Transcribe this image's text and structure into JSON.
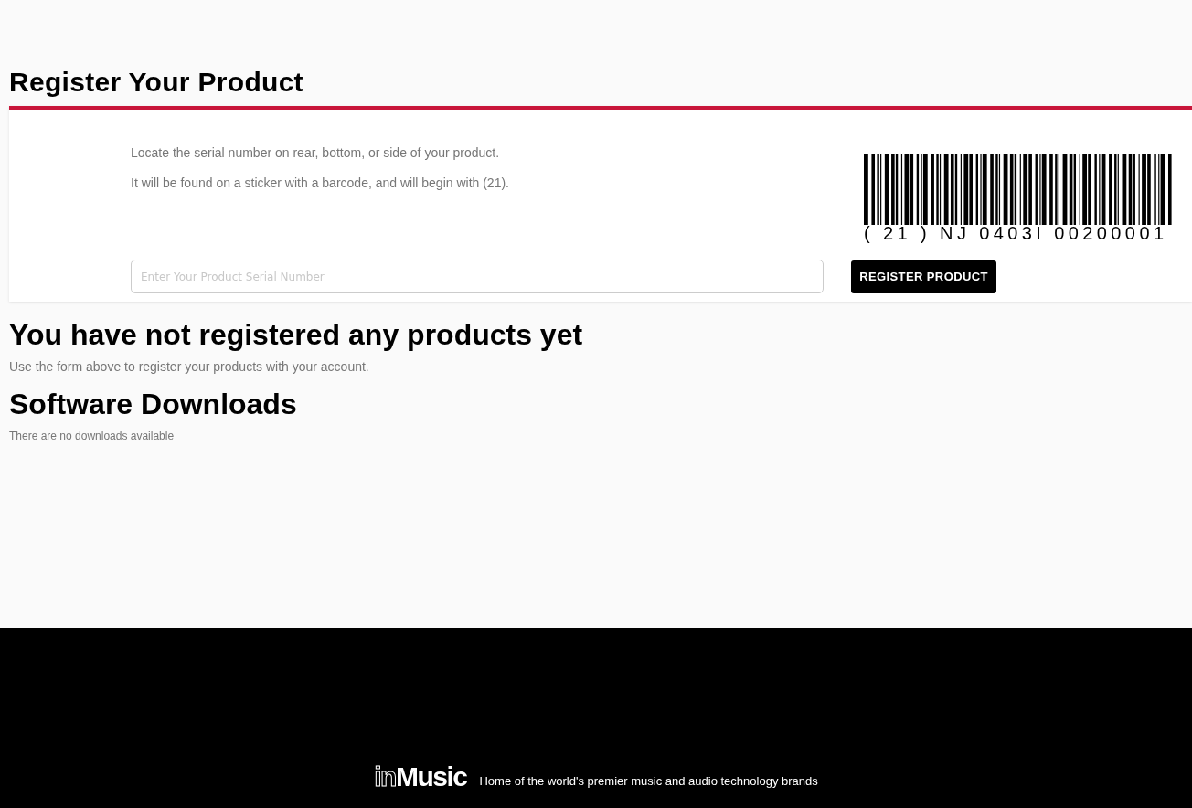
{
  "page": {
    "title": "Register Your Product"
  },
  "registration": {
    "instructions": [
      "Locate the serial number on rear, bottom, or side of your product.",
      "It will be found on a sticker with a barcode, and will begin with (21)."
    ],
    "serial_field": {
      "placeholder": "Enter Your Product Serial Number"
    },
    "barcode": {
      "caption": "( 21 ) NJ 0403I 00200001"
    },
    "submit_button": "REGISTER PRODUCT"
  },
  "registered_products": {
    "heading": "You have not registered any products yet",
    "message": "Use the form above to register your products with your account."
  },
  "software_downloads": {
    "heading": "Software Downloads",
    "message": "There are no downloads available"
  },
  "footer": {
    "logo": {
      "outlined": "in",
      "solid": "Music"
    },
    "tagline": "Home of the world's premier music and audio technology brands"
  }
}
